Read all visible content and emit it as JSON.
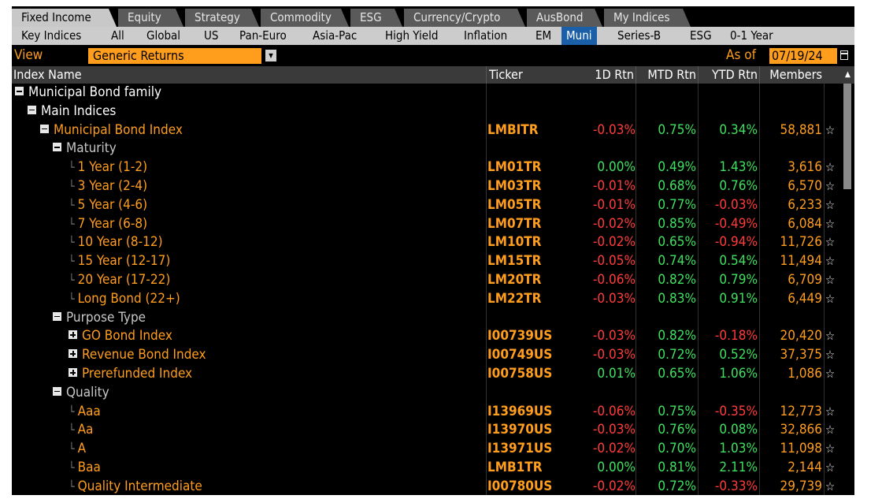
{
  "top_tabs": [
    {
      "label": "Fixed Income",
      "active": true
    },
    {
      "label": "Equity",
      "active": false
    },
    {
      "label": "Strategy",
      "active": false
    },
    {
      "label": "Commodity",
      "active": false
    },
    {
      "label": "ESG",
      "active": false
    },
    {
      "label": "Currency/Crypto",
      "active": false
    },
    {
      "label": "AusBond",
      "active": false
    },
    {
      "label": "My Indices",
      "active": false
    }
  ],
  "sub_tabs": [
    {
      "label": "Key Indices",
      "active": false
    },
    {
      "label": "All",
      "active": false
    },
    {
      "label": "Global",
      "active": false
    },
    {
      "label": "US",
      "active": false
    },
    {
      "label": "Pan-Euro",
      "active": false
    },
    {
      "label": "Asia-Pac",
      "active": false
    },
    {
      "label": "High Yield",
      "active": false
    },
    {
      "label": "Inflation",
      "active": false
    },
    {
      "label": "EM",
      "active": false
    },
    {
      "label": "Muni",
      "active": true
    },
    {
      "label": "Series-B",
      "active": false
    },
    {
      "label": "ESG",
      "active": false
    },
    {
      "label": "0-1 Year",
      "active": false
    }
  ],
  "view": {
    "label": "View",
    "selected": "Generic Returns"
  },
  "as_of": {
    "label": "As of",
    "date": "07/19/24"
  },
  "columns": {
    "name": "Index Name",
    "ticker": "Ticker",
    "d1": "1D Rtn",
    "mtd": "MTD Rtn",
    "ytd": "YTD Rtn",
    "members": "Members"
  },
  "rows": [
    {
      "name": "Municipal Bond family",
      "level": 0,
      "toggle": "minus",
      "style": "white"
    },
    {
      "name": "Main Indices",
      "level": 1,
      "toggle": "minus",
      "style": "white"
    },
    {
      "name": "Municipal Bond Index",
      "level": 2,
      "toggle": "minus",
      "style": "orange",
      "ticker": "LMBITR",
      "d1": "-0.03%",
      "mtd": "0.75%",
      "ytd": "0.34%",
      "members": "58,881"
    },
    {
      "name": "Maturity",
      "level": 3,
      "toggle": "minus",
      "style": "grey"
    },
    {
      "name": "1 Year (1-2)",
      "level": 4,
      "style": "orange",
      "ticker": "LM01TR",
      "d1": "0.00%",
      "mtd": "0.49%",
      "ytd": "1.43%",
      "members": "3,616"
    },
    {
      "name": "3 Year (2-4)",
      "level": 4,
      "style": "orange",
      "ticker": "LM03TR",
      "d1": "-0.01%",
      "mtd": "0.68%",
      "ytd": "0.76%",
      "members": "6,570"
    },
    {
      "name": "5 Year (4-6)",
      "level": 4,
      "style": "orange",
      "ticker": "LM05TR",
      "d1": "-0.01%",
      "mtd": "0.77%",
      "ytd": "-0.03%",
      "members": "6,233"
    },
    {
      "name": "7 Year (6-8)",
      "level": 4,
      "style": "orange",
      "ticker": "LM07TR",
      "d1": "-0.02%",
      "mtd": "0.85%",
      "ytd": "-0.49%",
      "members": "6,084"
    },
    {
      "name": "10 Year (8-12)",
      "level": 4,
      "style": "orange",
      "ticker": "LM10TR",
      "d1": "-0.02%",
      "mtd": "0.65%",
      "ytd": "-0.94%",
      "members": "11,726"
    },
    {
      "name": "15 Year (12-17)",
      "level": 4,
      "style": "orange",
      "ticker": "LM15TR",
      "d1": "-0.05%",
      "mtd": "0.74%",
      "ytd": "0.54%",
      "members": "11,494"
    },
    {
      "name": "20 Year (17-22)",
      "level": 4,
      "style": "orange",
      "ticker": "LM20TR",
      "d1": "-0.06%",
      "mtd": "0.82%",
      "ytd": "0.79%",
      "members": "6,709"
    },
    {
      "name": "Long Bond (22+)",
      "level": 4,
      "style": "orange",
      "ticker": "LM22TR",
      "d1": "-0.03%",
      "mtd": "0.83%",
      "ytd": "0.91%",
      "members": "6,449"
    },
    {
      "name": "Purpose Type",
      "level": 3,
      "toggle": "minus",
      "style": "grey"
    },
    {
      "name": "GO Bond Index",
      "level": 4,
      "toggle": "plus",
      "style": "orange",
      "ticker": "I00739US",
      "d1": "-0.03%",
      "mtd": "0.82%",
      "ytd": "-0.18%",
      "members": "20,420"
    },
    {
      "name": "Revenue Bond Index",
      "level": 4,
      "toggle": "plus",
      "style": "orange",
      "ticker": "I00749US",
      "d1": "-0.03%",
      "mtd": "0.72%",
      "ytd": "0.52%",
      "members": "37,375"
    },
    {
      "name": "Prerefunded Index",
      "level": 4,
      "toggle": "plus",
      "style": "orange",
      "ticker": "I00758US",
      "d1": "0.01%",
      "mtd": "0.65%",
      "ytd": "1.06%",
      "members": "1,086"
    },
    {
      "name": "Quality",
      "level": 3,
      "toggle": "minus",
      "style": "grey"
    },
    {
      "name": "Aaa",
      "level": 4,
      "style": "orange",
      "ticker": "I13969US",
      "d1": "-0.06%",
      "mtd": "0.75%",
      "ytd": "-0.35%",
      "members": "12,773"
    },
    {
      "name": "Aa",
      "level": 4,
      "style": "orange",
      "ticker": "I13970US",
      "d1": "-0.03%",
      "mtd": "0.76%",
      "ytd": "0.08%",
      "members": "32,866"
    },
    {
      "name": "A",
      "level": 4,
      "style": "orange",
      "ticker": "I13971US",
      "d1": "-0.02%",
      "mtd": "0.70%",
      "ytd": "1.03%",
      "members": "11,098"
    },
    {
      "name": "Baa",
      "level": 4,
      "style": "orange",
      "ticker": "LMB1TR",
      "d1": "0.00%",
      "mtd": "0.81%",
      "ytd": "2.11%",
      "members": "2,144"
    },
    {
      "name": "Quality Intermediate",
      "level": 4,
      "style": "orange",
      "ticker": "I00780US",
      "d1": "-0.02%",
      "mtd": "0.72%",
      "ytd": "-0.33%",
      "members": "29,739"
    }
  ],
  "colors": {
    "accent": "#ff9d1c",
    "positive": "#3fe060",
    "negative": "#ff3b3b",
    "active_subtab": "#1a5fa8"
  }
}
